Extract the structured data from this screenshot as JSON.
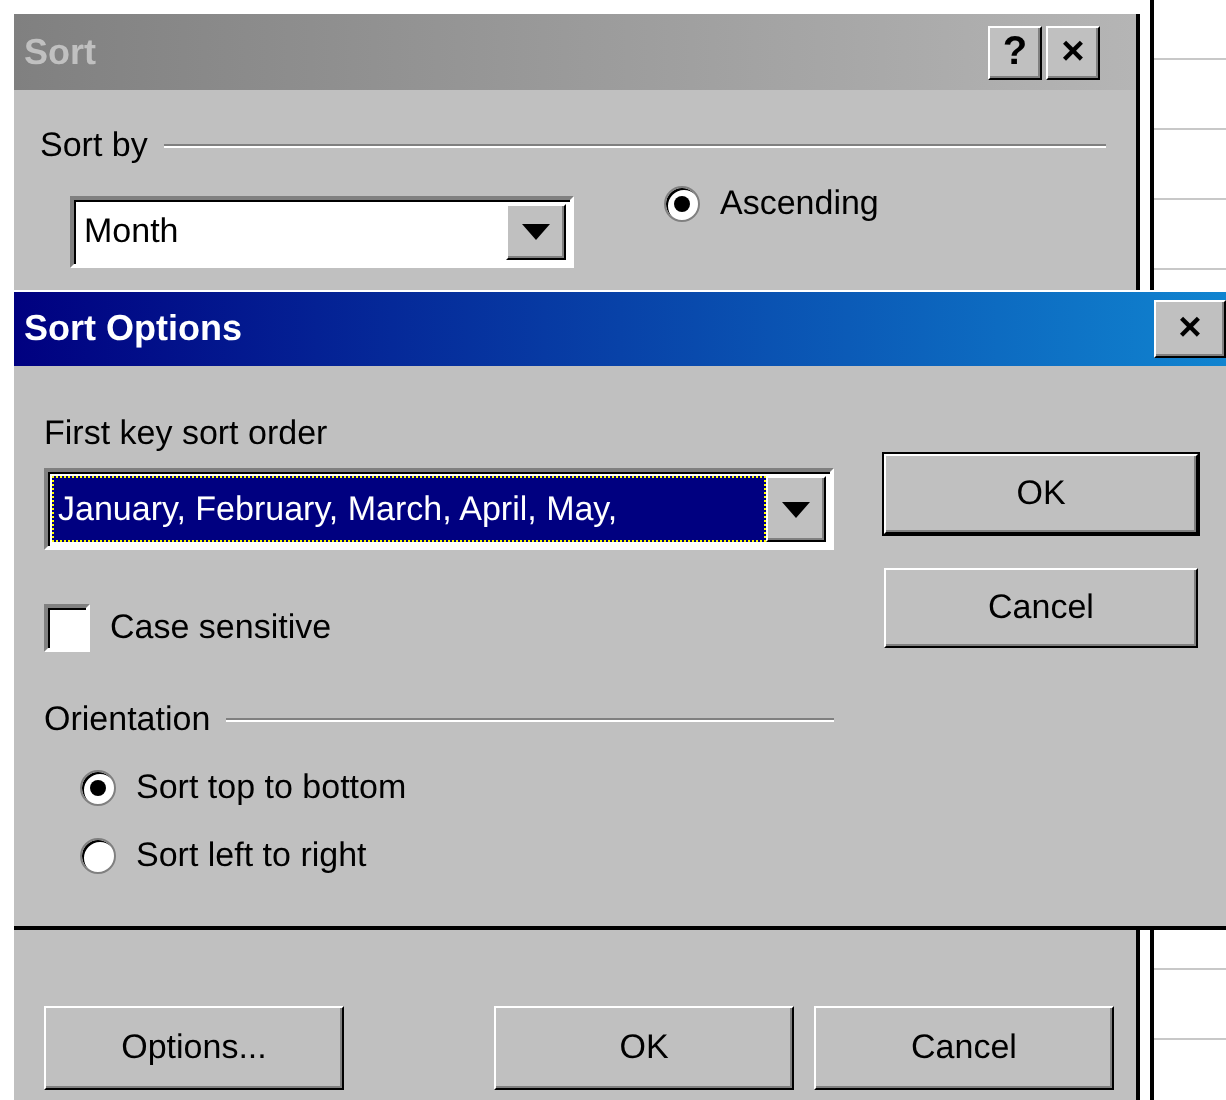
{
  "sort_dialog": {
    "title": "Sort",
    "title_buttons": [
      "?",
      "×"
    ],
    "sort_by": {
      "label": "Sort by",
      "field": {
        "value": "Month"
      },
      "order_options": [
        {
          "label": "Ascending",
          "selected": true
        }
      ]
    },
    "buttons": [
      "Options...",
      "OK",
      "Cancel"
    ]
  },
  "sort_options": {
    "title": "Sort Options",
    "close_button": "×",
    "first_key": {
      "label": "First key sort order",
      "value": "January, February, March, April, May,"
    },
    "case_sensitive": {
      "label": "Case sensitive",
      "checked": false
    },
    "orientation": {
      "label": "Orientation",
      "options": [
        {
          "label": "Sort top to bottom",
          "selected": true
        },
        {
          "label": "Sort left to right",
          "selected": false
        }
      ]
    },
    "buttons": [
      "OK",
      "Cancel"
    ]
  }
}
